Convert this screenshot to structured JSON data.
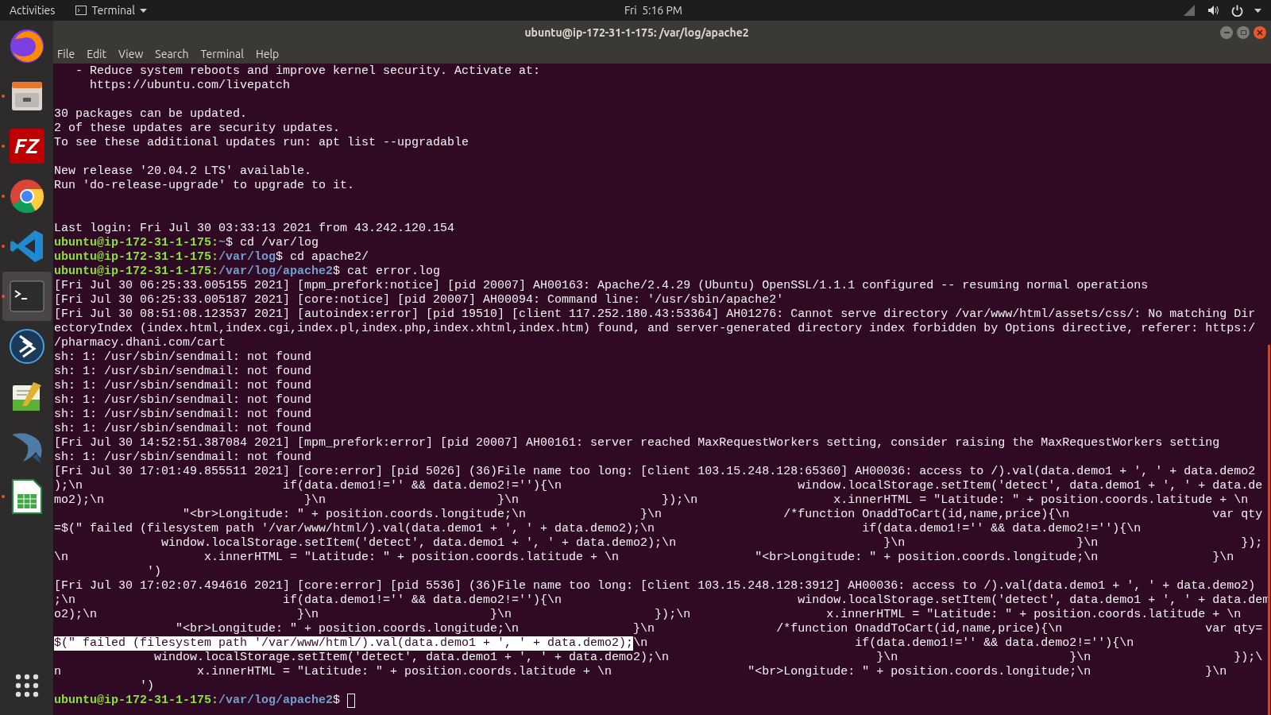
{
  "top_bar": {
    "activities": "Activities",
    "app_menu": "Terminal",
    "clock": "Fri  5:16 PM"
  },
  "dock": [
    {
      "kind": "browser",
      "running": false,
      "selected": false
    },
    {
      "kind": "files",
      "running": true,
      "selected": false
    },
    {
      "kind": "letters",
      "label": "FZ",
      "running": true,
      "selected": false
    },
    {
      "kind": "chrome",
      "running": true,
      "selected": false
    },
    {
      "kind": "code",
      "running": true,
      "selected": false
    },
    {
      "kind": "terminal",
      "running": true,
      "selected": true
    },
    {
      "kind": "arrows",
      "running": false,
      "selected": false
    },
    {
      "kind": "editor",
      "running": false,
      "selected": false
    },
    {
      "kind": "dolphin",
      "running": false,
      "selected": false
    },
    {
      "kind": "sheet",
      "running": true,
      "selected": false
    }
  ],
  "window": {
    "title": "ubuntu@ip-172-31-1-175: /var/log/apache2",
    "menu": [
      "File",
      "Edit",
      "View",
      "Search",
      "Terminal",
      "Help"
    ]
  },
  "terminal": {
    "lines": [
      {
        "kind": "output",
        "text": "   - Reduce system reboots and improve kernel security. Activate at:"
      },
      {
        "kind": "output",
        "text": "     https://ubuntu.com/livepatch"
      },
      {
        "kind": "blank"
      },
      {
        "kind": "output",
        "text": "30 packages can be updated."
      },
      {
        "kind": "output",
        "text": "2 of these updates are security updates."
      },
      {
        "kind": "output",
        "text": "To see these additional updates run: apt list --upgradable"
      },
      {
        "kind": "blank"
      },
      {
        "kind": "output",
        "text": "New release '20.04.2 LTS' available."
      },
      {
        "kind": "output",
        "text": "Run 'do-release-upgrade' to upgrade to it."
      },
      {
        "kind": "blank"
      },
      {
        "kind": "blank"
      },
      {
        "kind": "output",
        "text": "Last login: Fri Jul 30 03:33:13 2021 from 43.242.120.154"
      },
      {
        "kind": "prompt",
        "user_host": "ubuntu@ip-172-31-1-175:",
        "path": "~",
        "command": "$ cd /var/log",
        "cursor": false
      },
      {
        "kind": "prompt",
        "user_host": "ubuntu@ip-172-31-1-175:",
        "path": "/var/log",
        "command": "$ cd apache2/",
        "cursor": false
      },
      {
        "kind": "prompt",
        "user_host": "ubuntu@ip-172-31-1-175:",
        "path": "/var/log/apache2",
        "command": "$ cat error.log",
        "cursor": false
      },
      {
        "kind": "output",
        "text": "[Fri Jul 30 06:25:33.005155 2021] [mpm_prefork:notice] [pid 20007] AH00163: Apache/2.4.29 (Ubuntu) OpenSSL/1.1.1 configured -- resuming normal operations"
      },
      {
        "kind": "output",
        "text": "[Fri Jul 30 06:25:33.005187 2021] [core:notice] [pid 20007] AH00094: Command line: '/usr/sbin/apache2'"
      },
      {
        "kind": "output",
        "text": "[Fri Jul 30 08:51:08.123537 2021] [autoindex:error] [pid 19510] [client 117.252.180.43:53364] AH01276: Cannot serve directory /var/www/html/assets/css/: No matching Dir"
      },
      {
        "kind": "output",
        "text": "ectoryIndex (index.html,index.cgi,index.pl,index.php,index.xhtml,index.htm) found, and server-generated directory index forbidden by Options directive, referer: https:/"
      },
      {
        "kind": "output",
        "text": "/pharmacy.dhani.com/cart"
      },
      {
        "kind": "output",
        "text": "sh: 1: /usr/sbin/sendmail: not found"
      },
      {
        "kind": "output",
        "text": "sh: 1: /usr/sbin/sendmail: not found"
      },
      {
        "kind": "output",
        "text": "sh: 1: /usr/sbin/sendmail: not found"
      },
      {
        "kind": "output",
        "text": "sh: 1: /usr/sbin/sendmail: not found"
      },
      {
        "kind": "output",
        "text": "sh: 1: /usr/sbin/sendmail: not found"
      },
      {
        "kind": "output",
        "text": "sh: 1: /usr/sbin/sendmail: not found"
      },
      {
        "kind": "output",
        "text": "[Fri Jul 30 14:52:51.387084 2021] [mpm_prefork:error] [pid 20007] AH00161: server reached MaxRequestWorkers setting, consider raising the MaxRequestWorkers setting"
      },
      {
        "kind": "output",
        "text": "sh: 1: /usr/sbin/sendmail: not found"
      },
      {
        "kind": "output",
        "text": "[Fri Jul 30 17:01:49.855511 2021] [core:error] [pid 5026] (36)File name too long: [client 103.15.248.128:65360] AH00036: access to /).val(data.demo1 + ', ' + data.demo2"
      },
      {
        "kind": "output",
        "text": ");\\n                            if(data.demo1!='' && data.demo2!=''){\\n                                 window.localStorage.setItem('detect', data.demo1 + ', ' + data.de"
      },
      {
        "kind": "output",
        "text": "mo2);\\n                            }\\n                        }\\n                    });\\n                   x.innerHTML = \"Latitude: \" + position.coords.latitude + \\n"
      },
      {
        "kind": "output",
        "text": "                  \"<br>Longitude: \" + position.coords.longitude;\\n                }\\n                 /*function OnaddToCart(id,name,price){\\n                    var qty"
      },
      {
        "kind": "output",
        "text": "=$(\" failed (filesystem path '/var/www/html/).val(data.demo1 + ', ' + data.demo2);\\n                             if(data.demo1!='' && data.demo2!=''){\\n"
      },
      {
        "kind": "output",
        "text": "               window.localStorage.setItem('detect', data.demo1 + ', ' + data.demo2);\\n                             }\\n                        }\\n                    });"
      },
      {
        "kind": "output",
        "text": "\\n                   x.innerHTML = \"Latitude: \" + position.coords.latitude + \\n                   \"<br>Longitude: \" + position.coords.longitude;\\n                }\\n"
      },
      {
        "kind": "output",
        "text": "             ')"
      },
      {
        "kind": "output",
        "text": "[Fri Jul 30 17:02:07.494616 2021] [core:error] [pid 5536] (36)File name too long: [client 103.15.248.128:3912] AH00036: access to /).val(data.demo1 + ', ' + data.demo2)"
      },
      {
        "kind": "output",
        "text": ";\\n                             if(data.demo1!='' && data.demo2!=''){\\n                                 window.localStorage.setItem('detect', data.demo1 + ', ' + data.dem"
      },
      {
        "kind": "output",
        "text": "o2);\\n                            }\\n                        }\\n                    });\\n                   x.innerHTML = \"Latitude: \" + position.coords.latitude + \\n"
      },
      {
        "kind": "output",
        "text": "                 \"<br>Longitude: \" + position.coords.longitude;\\n                }\\n                 /*function OnaddToCart(id,name,price){\\n                    var qty="
      },
      {
        "kind": "output",
        "selected_text": "$(\" failed (filesystem path '/var/www/html/).val(data.demo1 + ', ' + data.demo2);",
        "text": "\\n                             if(data.demo1!='' && data.demo2!=''){\\n"
      },
      {
        "kind": "output",
        "text": "              window.localStorage.setItem('detect', data.demo1 + ', ' + data.demo2);\\n                             }\\n                        }\\n                    });\\"
      },
      {
        "kind": "output",
        "text": "n                   x.innerHTML = \"Latitude: \" + position.coords.latitude + \\n                   \"<br>Longitude: \" + position.coords.longitude;\\n                }\\n"
      },
      {
        "kind": "output",
        "text": "            ')"
      },
      {
        "kind": "prompt",
        "user_host": "ubuntu@ip-172-31-1-175:",
        "path": "/var/log/apache2",
        "command": "$ ",
        "cursor": true
      }
    ]
  }
}
